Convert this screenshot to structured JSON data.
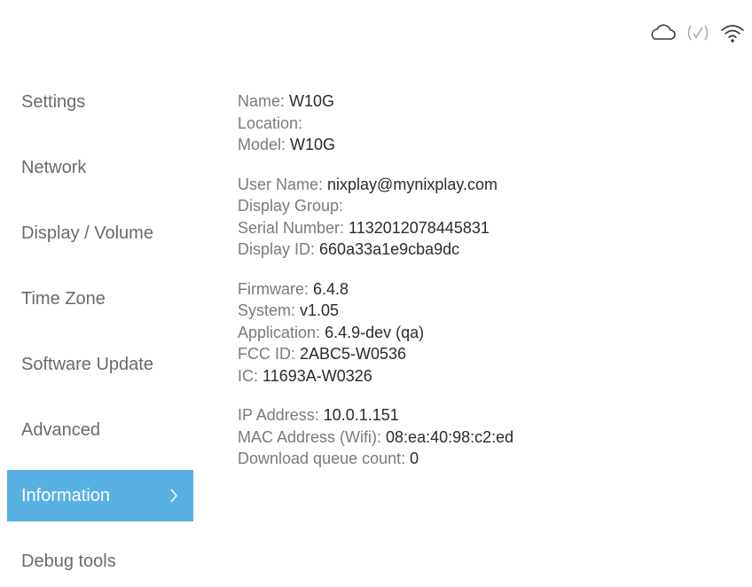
{
  "status_icons": [
    "cloud-icon",
    "signal-status-icon",
    "wifi-icon"
  ],
  "colors": {
    "accent": "#58b0e3",
    "label_text": "#7a7a7a",
    "value_text": "#2b2b2b",
    "menu_text": "#6a6a6a",
    "active_text": "#ffffff"
  },
  "sidebar": {
    "items": [
      {
        "label": "Settings"
      },
      {
        "label": "Network"
      },
      {
        "label": "Display / Volume"
      },
      {
        "label": "Time Zone"
      },
      {
        "label": "Software Update"
      },
      {
        "label": "Advanced"
      },
      {
        "label": "Information",
        "active": true
      },
      {
        "label": "Debug tools"
      }
    ],
    "active_chevron": ">"
  },
  "info": {
    "groups": [
      {
        "lines": [
          {
            "label": "Name: ",
            "value": "W10G"
          },
          {
            "label": "Location: ",
            "value": ""
          },
          {
            "label": "Model: ",
            "value": "W10G"
          }
        ]
      },
      {
        "lines": [
          {
            "label": "User Name: ",
            "value": "nixplay@mynixplay.com"
          },
          {
            "label": "Display Group: ",
            "value": ""
          },
          {
            "label": "Serial Number: ",
            "value": "1132012078445831"
          },
          {
            "label": "Display ID: ",
            "value": "660a33a1e9cba9dc"
          }
        ]
      },
      {
        "lines": [
          {
            "label": "Firmware: ",
            "value": "6.4.8"
          },
          {
            "label": "System: ",
            "value": "v1.05"
          },
          {
            "label": "Application: ",
            "value": "6.4.9-dev (qa)"
          },
          {
            "label": "FCC ID: ",
            "value": "2ABC5-W0536"
          },
          {
            "label": "IC: ",
            "value": "11693A-W0326"
          }
        ]
      },
      {
        "lines": [
          {
            "label": "IP Address: ",
            "value": "10.0.1.151"
          },
          {
            "label": "MAC Address (Wifi): ",
            "value": "08:ea:40:98:c2:ed"
          },
          {
            "label": "Download queue count: ",
            "value": "0"
          }
        ]
      }
    ]
  }
}
